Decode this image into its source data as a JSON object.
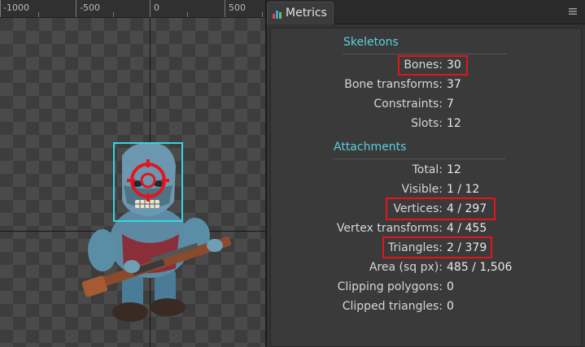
{
  "ruler": {
    "labels": [
      "-1000",
      "-500",
      "0",
      "500"
    ]
  },
  "panel": {
    "tab_label": "Metrics"
  },
  "skeletons": {
    "title": "Skeletons",
    "rows": [
      {
        "label": "Bones:",
        "value": "30"
      },
      {
        "label": "Bone transforms:",
        "value": "37"
      },
      {
        "label": "Constraints:",
        "value": "7"
      },
      {
        "label": "Slots:",
        "value": "12"
      }
    ]
  },
  "attachments": {
    "title": "Attachments",
    "rows": [
      {
        "label": "Total:",
        "value": "12"
      },
      {
        "label": "Visible:",
        "value": "1 / 12"
      },
      {
        "label": "Vertices:",
        "value": "4 / 297"
      },
      {
        "label": "Vertex transforms:",
        "value": "4 / 455"
      },
      {
        "label": "Triangles:",
        "value": "2 / 379"
      },
      {
        "label": "Area (sq px):",
        "value": "485 / 1,506"
      },
      {
        "label": "Clipping polygons:",
        "value": "0"
      },
      {
        "label": "Clipped triangles:",
        "value": "0"
      }
    ]
  },
  "colors": {
    "section_title": "#5ad0e0",
    "highlight": "#e2151d",
    "selection": "#33d6e6"
  },
  "icons": {
    "tab": "bar-chart-icon",
    "menu": "hamburger-menu-icon"
  }
}
